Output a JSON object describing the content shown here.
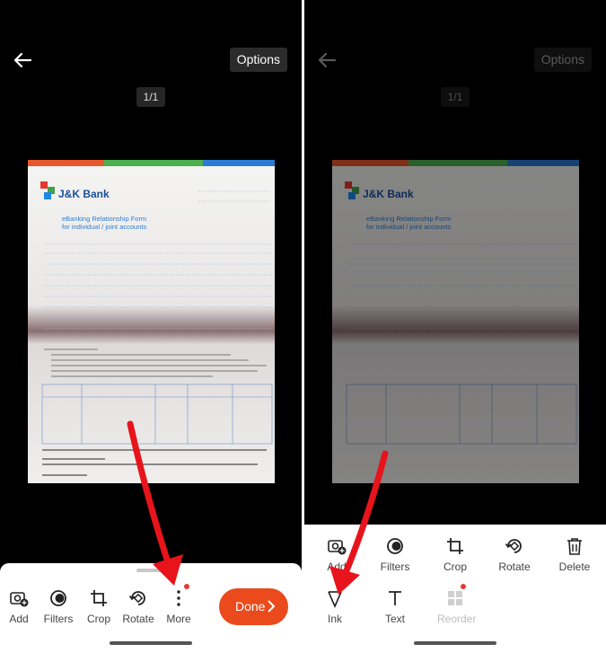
{
  "left": {
    "options_label": "Options",
    "page_count": "1/1",
    "toolbar": [
      {
        "label": "Add",
        "icon": "add-photo-icon"
      },
      {
        "label": "Filters",
        "icon": "filters-icon"
      },
      {
        "label": "Crop",
        "icon": "crop-icon"
      },
      {
        "label": "Rotate",
        "icon": "rotate-icon"
      },
      {
        "label": "More",
        "icon": "more-vertical-icon"
      }
    ],
    "done_label": "Done"
  },
  "right": {
    "options_label": "Options",
    "page_count": "1/1",
    "row1": [
      {
        "label": "Add",
        "icon": "add-photo-icon"
      },
      {
        "label": "Filters",
        "icon": "filters-icon"
      },
      {
        "label": "Crop",
        "icon": "crop-icon"
      },
      {
        "label": "Rotate",
        "icon": "rotate-icon"
      },
      {
        "label": "Delete",
        "icon": "delete-icon"
      }
    ],
    "row2": [
      {
        "label": "Ink",
        "icon": "ink-icon"
      },
      {
        "label": "Text",
        "icon": "text-icon"
      },
      {
        "label": "Reorder",
        "icon": "reorder-icon",
        "disabled": true
      }
    ]
  },
  "document": {
    "bank_name": "J&K Bank",
    "form_title_1": "eBanking Relationship Form",
    "form_title_2": "for individual / joint accounts"
  },
  "colors": {
    "accent": "#ea4a1c",
    "annotation_arrow": "#e8141b"
  }
}
